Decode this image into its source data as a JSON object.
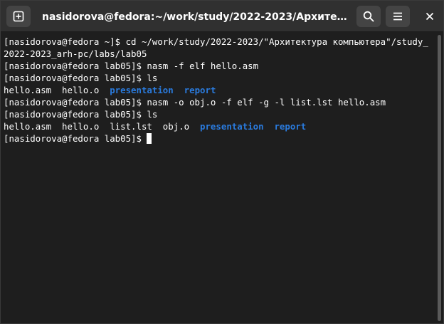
{
  "window": {
    "title": "nasidorova@fedora:~/work/study/2022-2023/Архитектура комп…"
  },
  "icons": {
    "new_tab": "new-tab-icon",
    "search": "search-icon",
    "menu": "hamburger-menu-icon",
    "close": "close-icon"
  },
  "colors": {
    "background": "#1e1e1e",
    "titlebar": "#303030",
    "text": "#ffffff",
    "directory": "#2a7bde"
  },
  "terminal": {
    "lines": [
      {
        "segments": [
          {
            "text": "[nasidorova@fedora ~]$ cd ~/work/study/2022-2023/\"Архитектура компьютера\"/study_"
          }
        ]
      },
      {
        "segments": [
          {
            "text": "2022-2023_arh-pc/labs/lab05"
          }
        ]
      },
      {
        "segments": [
          {
            "text": "[nasidorova@fedora lab05]$ nasm -f elf hello.asm"
          }
        ]
      },
      {
        "segments": [
          {
            "text": "[nasidorova@fedora lab05]$ ls"
          }
        ]
      },
      {
        "segments": [
          {
            "text": "hello.asm  hello.o  "
          },
          {
            "text": "presentation",
            "dir": true
          },
          {
            "text": "  "
          },
          {
            "text": "report",
            "dir": true
          }
        ]
      },
      {
        "segments": [
          {
            "text": "[nasidorova@fedora lab05]$ nasm -o obj.o -f elf -g -l list.lst hello.asm"
          }
        ]
      },
      {
        "segments": [
          {
            "text": "[nasidorova@fedora lab05]$ ls"
          }
        ]
      },
      {
        "segments": [
          {
            "text": "hello.asm  hello.o  list.lst  obj.o  "
          },
          {
            "text": "presentation",
            "dir": true
          },
          {
            "text": "  "
          },
          {
            "text": "report",
            "dir": true
          }
        ]
      },
      {
        "segments": [
          {
            "text": "[nasidorova@fedora lab05]$ "
          }
        ],
        "cursor": true
      }
    ]
  }
}
